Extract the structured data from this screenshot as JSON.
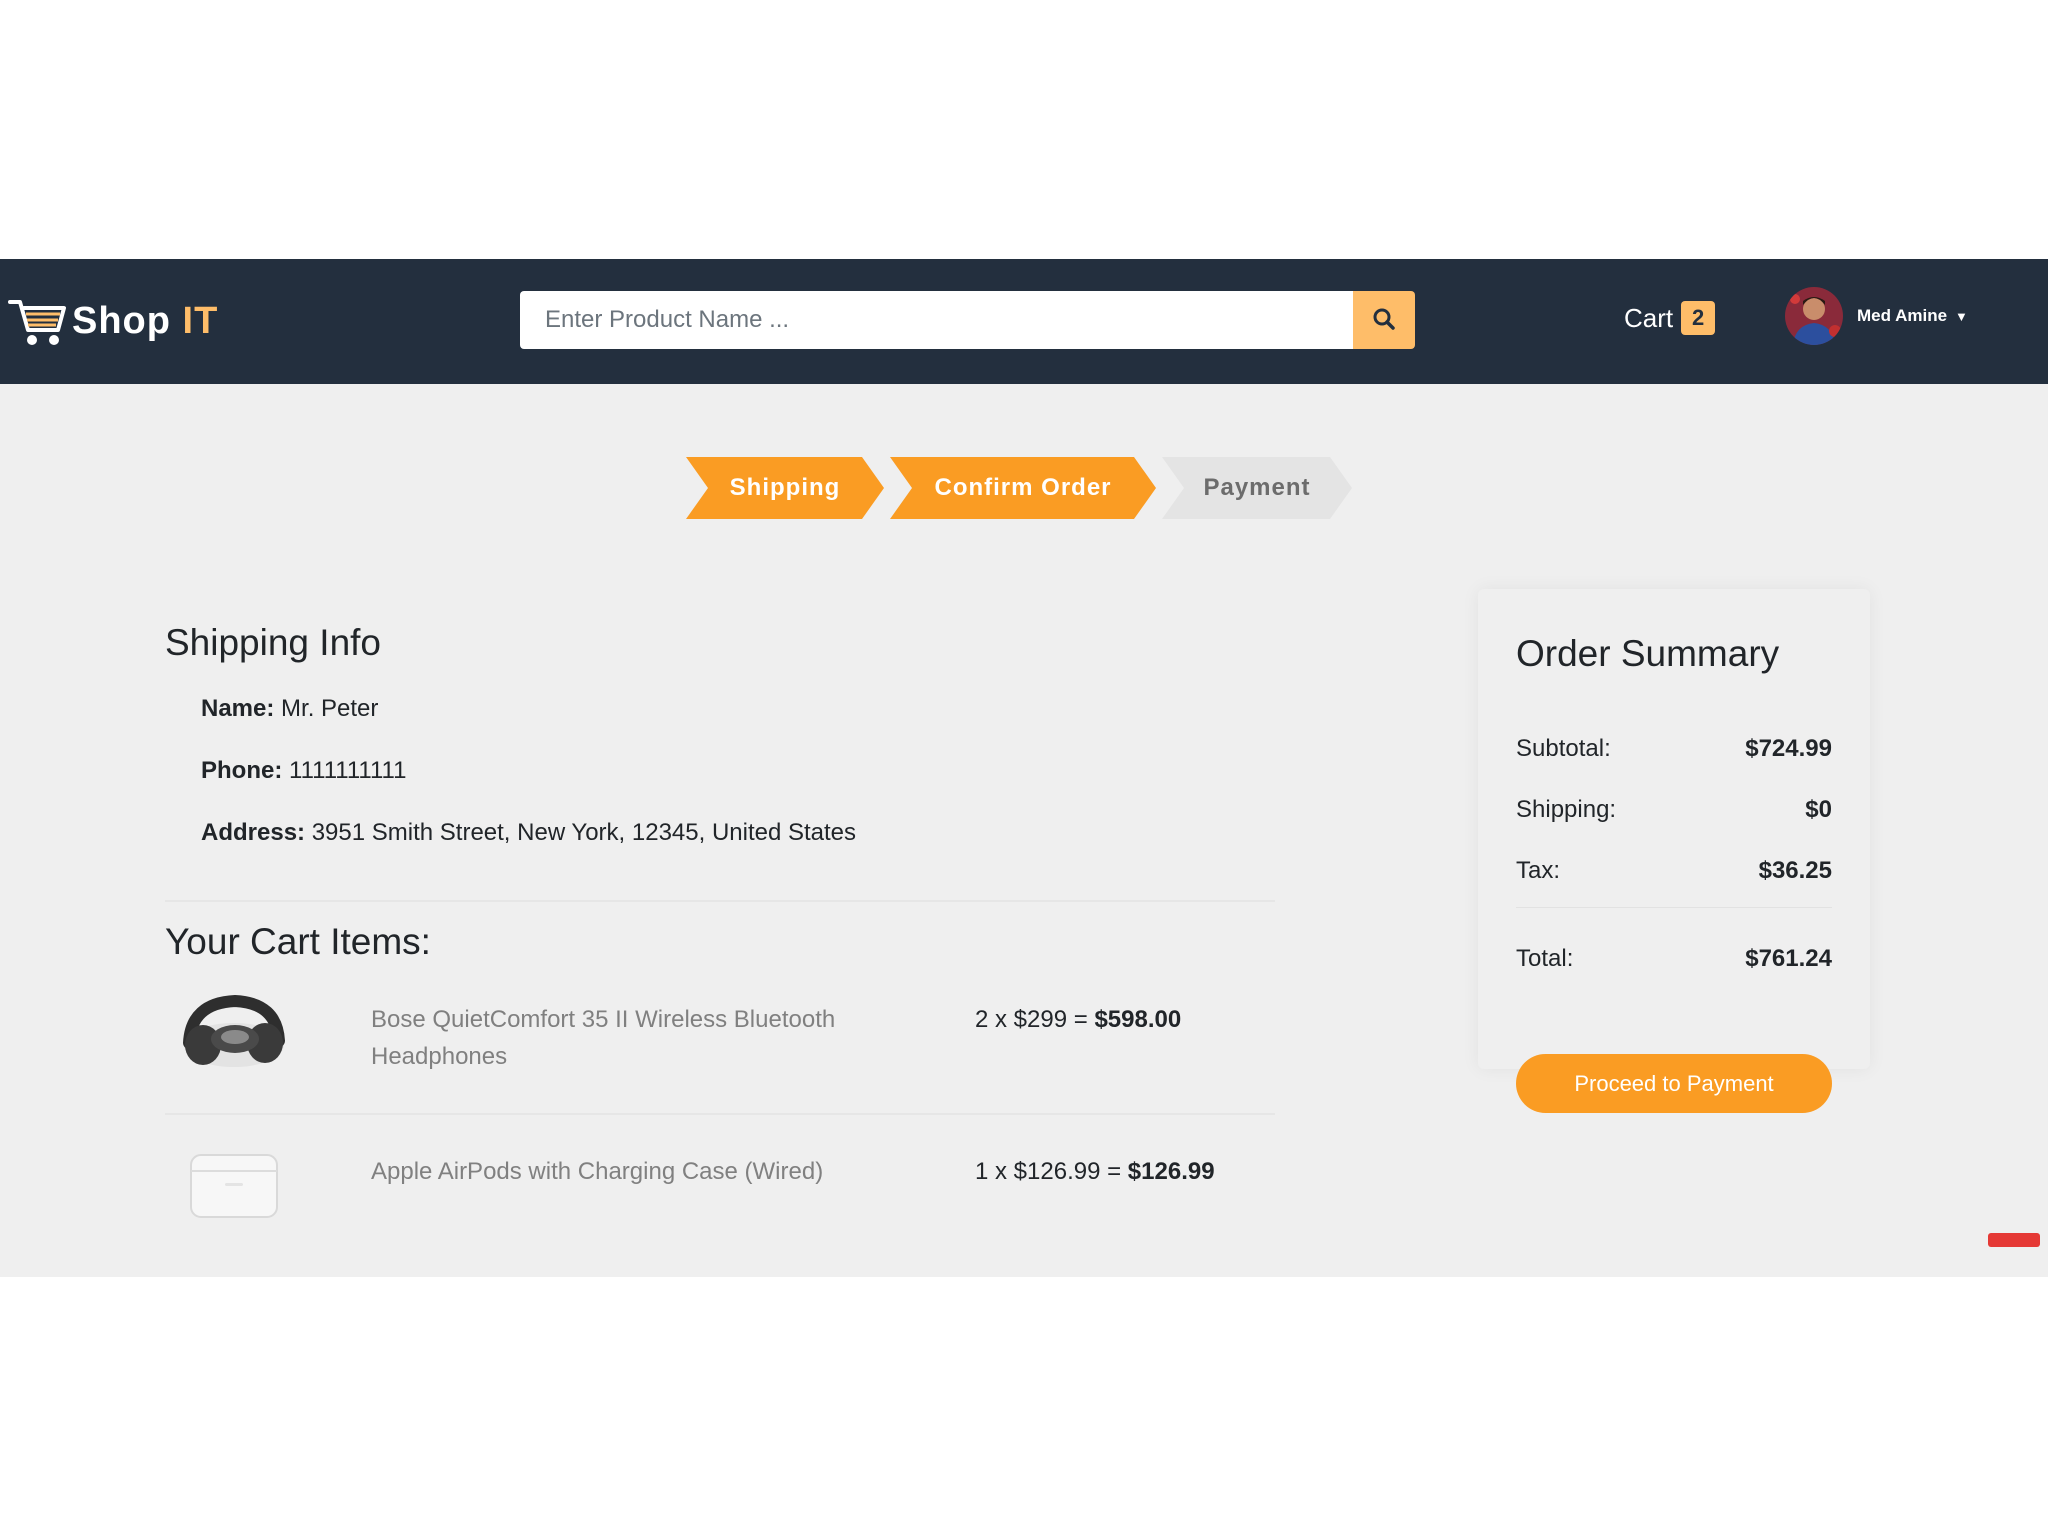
{
  "navbar": {
    "logo": {
      "part1": "Shop ",
      "part2": "IT"
    },
    "search": {
      "placeholder": "Enter Product Name ..."
    },
    "cart": {
      "label": "Cart",
      "count": "2"
    },
    "user": {
      "name": "Med Amine"
    },
    "icons": {
      "logo": "shopping-cart-icon",
      "search": "search-icon",
      "user_menu": "caret-down-icon"
    }
  },
  "steps": [
    {
      "label": "Shipping",
      "state": "active"
    },
    {
      "label": "Confirm Order",
      "state": "active"
    },
    {
      "label": "Payment",
      "state": "inactive"
    }
  ],
  "shipping_info": {
    "title": "Shipping Info",
    "name_label": "Name:",
    "name_value": "Mr. Peter",
    "phone_label": "Phone:",
    "phone_value": "1111111111",
    "address_label": "Address:",
    "address_value": "3951 Smith Street, New York, 12345, United States"
  },
  "cart_items": {
    "title": "Your Cart Items:",
    "items": [
      {
        "name": "Bose QuietComfort 35 II Wireless Bluetooth Headphones",
        "qty_price": "2 x $299 = ",
        "total": "$598.00"
      },
      {
        "name": "Apple AirPods with Charging Case (Wired)",
        "qty_price": "1 x $126.99 = ",
        "total": "$126.99"
      }
    ]
  },
  "order_summary": {
    "title": "Order Summary",
    "subtotal_label": "Subtotal:",
    "subtotal_value": "$724.99",
    "shipping_label": "Shipping:",
    "shipping_value": "$0",
    "tax_label": "Tax:",
    "tax_value": "$36.25",
    "total_label": "Total:",
    "total_value": "$761.24",
    "button_label": "Proceed to Payment"
  },
  "colors": {
    "navbar": "#232f3e",
    "accent": "#fa9c23",
    "search_button": "#febd69",
    "page_background": "#efefef"
  }
}
